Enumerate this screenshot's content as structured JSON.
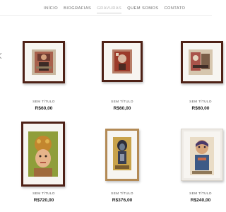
{
  "nav": {
    "items": [
      {
        "label": "INÍCIO",
        "active": false
      },
      {
        "label": "BIOGRAFIAS",
        "active": false
      },
      {
        "label": "GRAVURAS",
        "active": true
      },
      {
        "label": "QUEM SOMOS",
        "active": false
      },
      {
        "label": "CONTATO",
        "active": false
      }
    ]
  },
  "products": [
    {
      "title": "SEM TÍTULO",
      "price": "R$60,00",
      "frame": "dark"
    },
    {
      "title": "SEM TÍTULO",
      "price": "R$60,00",
      "frame": "dark"
    },
    {
      "title": "SEM TÍTULO",
      "price": "R$60,00",
      "frame": "dark"
    },
    {
      "title": "SEM TÍTULO",
      "price": "R$720,00",
      "frame": "dark"
    },
    {
      "title": "SEM TÍTULO",
      "price": "R$376,00",
      "frame": "wood"
    },
    {
      "title": "SEM TÍTULO",
      "price": "R$240,00",
      "frame": "white"
    }
  ]
}
